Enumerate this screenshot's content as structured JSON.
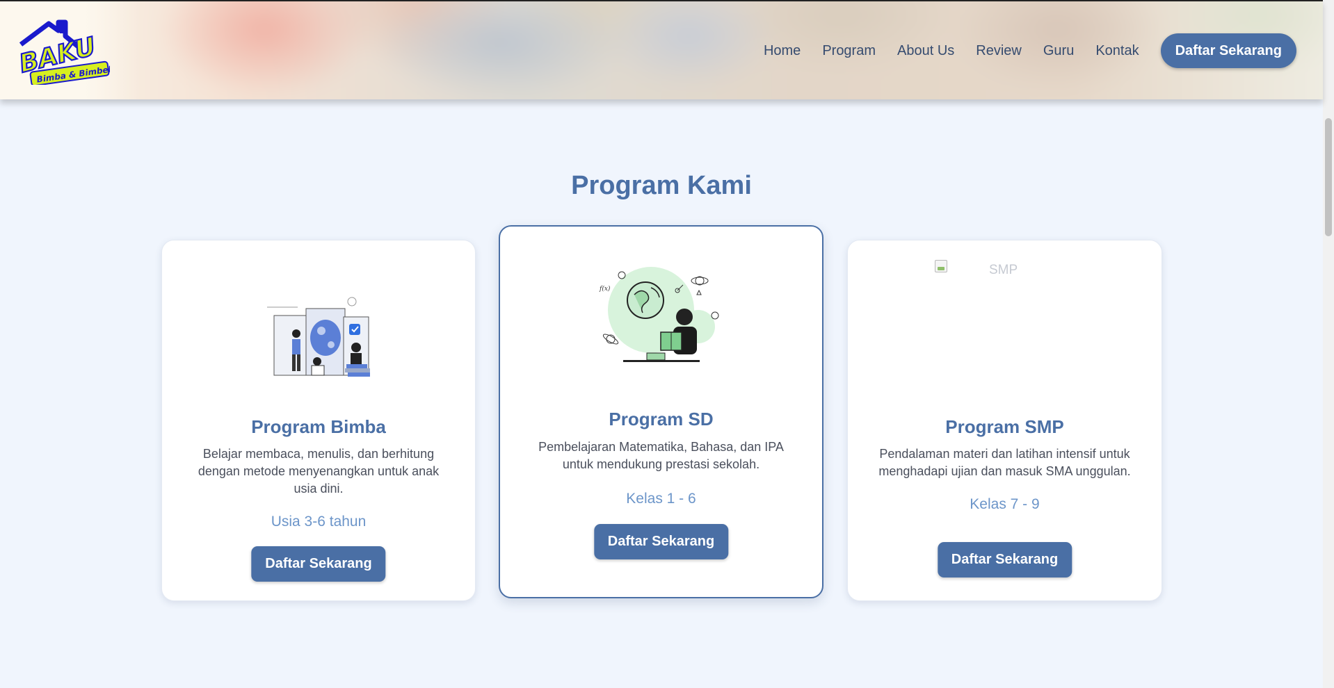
{
  "header": {
    "logo_alt": "BAKU Bimba & Bimbel",
    "nav": [
      "Home",
      "Program",
      "About Us",
      "Review",
      "Guru",
      "Kontak"
    ],
    "cta_label": "Daftar Sekarang"
  },
  "section": {
    "title": "Program Kami"
  },
  "cards": [
    {
      "title": "Program Bimba",
      "description": "Belajar membaca, menulis, dan berhitung dengan metode menyenangkan untuk anak usia dini.",
      "meta": "Usia 3-6 tahun",
      "button_label": "Daftar Sekarang"
    },
    {
      "title": "Program SD",
      "description": "Pembelajaran Matematika, Bahasa, dan IPA untuk mendukung prestasi sekolah.",
      "meta": "Kelas 1 - 6",
      "button_label": "Daftar Sekarang"
    },
    {
      "title": "Program SMP",
      "description": "Pendalaman materi dan latihan intensif untuk menghadapi ujian dan masuk SMA unggulan.",
      "meta": "Kelas 7 - 9",
      "button_label": "Daftar Sekarang",
      "image_alt": "SMP"
    }
  ],
  "colors": {
    "primary": "#4a6fa5",
    "accent_text": "#6c95c9",
    "page_bg": "#f0f5fd"
  }
}
